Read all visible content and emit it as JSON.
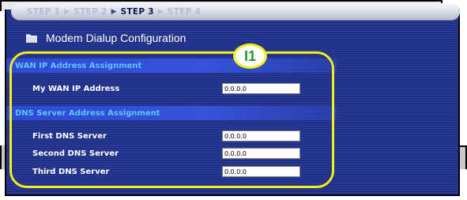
{
  "steps": [
    "STEP 1",
    "STEP 2",
    "STEP 3",
    "STEP 4"
  ],
  "page_title": "Modem Dialup Configuration",
  "callout": "I1",
  "wan_section": {
    "title": "WAN IP Address Assignment",
    "fields": [
      {
        "label": "My WAN IP Address",
        "value": "0.0.0.0"
      }
    ]
  },
  "dns_section": {
    "title": "DNS Server Address Assignment",
    "fields": [
      {
        "label": "First DNS Server",
        "value": "0.0.0.0"
      },
      {
        "label": "Second DNS Server",
        "value": "0.0.0.0"
      },
      {
        "label": "Third DNS Server",
        "value": "0.0.0.0"
      }
    ]
  },
  "colors": {
    "panel_bg": "#1f2f8a",
    "section_head_text": "#61c4f2",
    "highlight": "#f2ee17",
    "callout_text": "#1f9a2c"
  }
}
